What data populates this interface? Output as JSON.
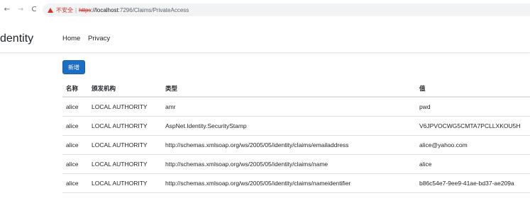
{
  "browser": {
    "back_icon": "back-arrow-icon",
    "forward_icon": "forward-arrow-icon",
    "reload_icon": "reload-icon",
    "security_label": "不安全",
    "url_scheme": "https",
    "url_host": "://localhost",
    "url_rest": ":7296/Claims/PrivateAccess"
  },
  "navbar": {
    "brand": "dentity",
    "links": [
      {
        "label": "Home"
      },
      {
        "label": "Privacy"
      }
    ]
  },
  "page": {
    "add_button_label": "新增"
  },
  "table": {
    "headers": [
      "名称",
      "颁发机构",
      "类型",
      "值"
    ],
    "rows": [
      [
        "alice",
        "LOCAL AUTHORITY",
        "amr",
        "pwd"
      ],
      [
        "alice",
        "LOCAL AUTHORITY",
        "AspNet.Identity.SecurityStamp",
        "V6JPVOCWG5CMTA7PCLLXKOU5H"
      ],
      [
        "alice",
        "LOCAL AUTHORITY",
        "http://schemas.xmlsoap.org/ws/2005/05/identity/claims/emailaddress",
        "alice@yahoo.com"
      ],
      [
        "alice",
        "LOCAL AUTHORITY",
        "http://schemas.xmlsoap.org/ws/2005/05/identity/claims/name",
        "alice"
      ],
      [
        "alice",
        "LOCAL AUTHORITY",
        "http://schemas.xmlsoap.org/ws/2005/05/identity/claims/nameidentifier",
        "b86c54e7-9ee9-41ae-bd37-ae209a"
      ]
    ]
  },
  "colors": {
    "primary": "#1b6ec2",
    "insecure": "#d93025"
  }
}
